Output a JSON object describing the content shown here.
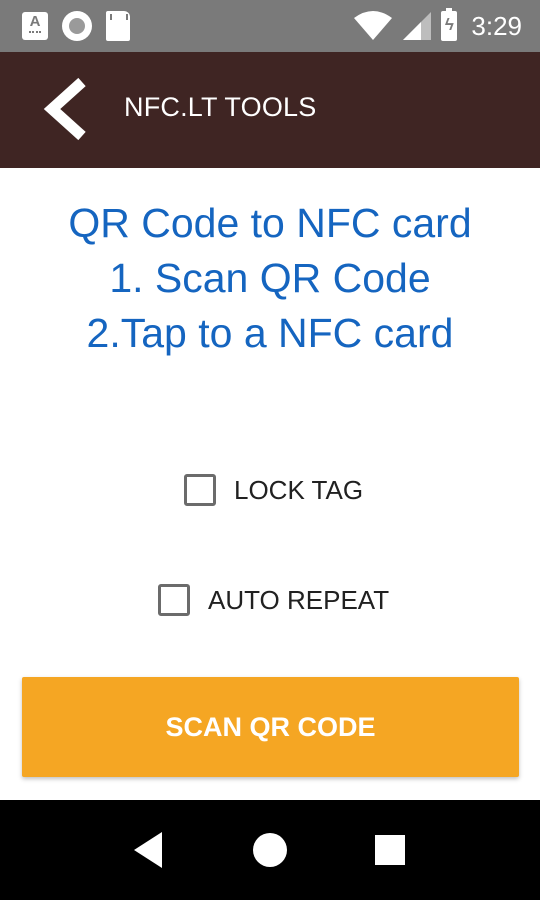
{
  "status_bar": {
    "time": "3:29",
    "icons": [
      "a-badge-icon",
      "record-icon",
      "sd-card-icon",
      "wifi-icon",
      "signal-icon",
      "battery-charging-icon"
    ],
    "a_badge_letter": "A"
  },
  "app_bar": {
    "title": "NFC.LT TOOLS",
    "background_color": "#3f2523",
    "back_icon": "chevron-left-icon"
  },
  "instructions": {
    "line1": "QR Code to NFC card",
    "line2": "1. Scan QR Code",
    "line3": "2.Tap to a NFC card",
    "color": "#1565c0"
  },
  "options": {
    "lock_tag": {
      "label": "LOCK TAG",
      "checked": false
    },
    "auto_repeat": {
      "label": "AUTO REPEAT",
      "checked": false
    }
  },
  "scan_button": {
    "label": "SCAN QR CODE",
    "color": "#f5a623"
  },
  "nav_bar": {
    "icons": [
      "nav-back-icon",
      "nav-home-icon",
      "nav-recents-icon"
    ]
  }
}
